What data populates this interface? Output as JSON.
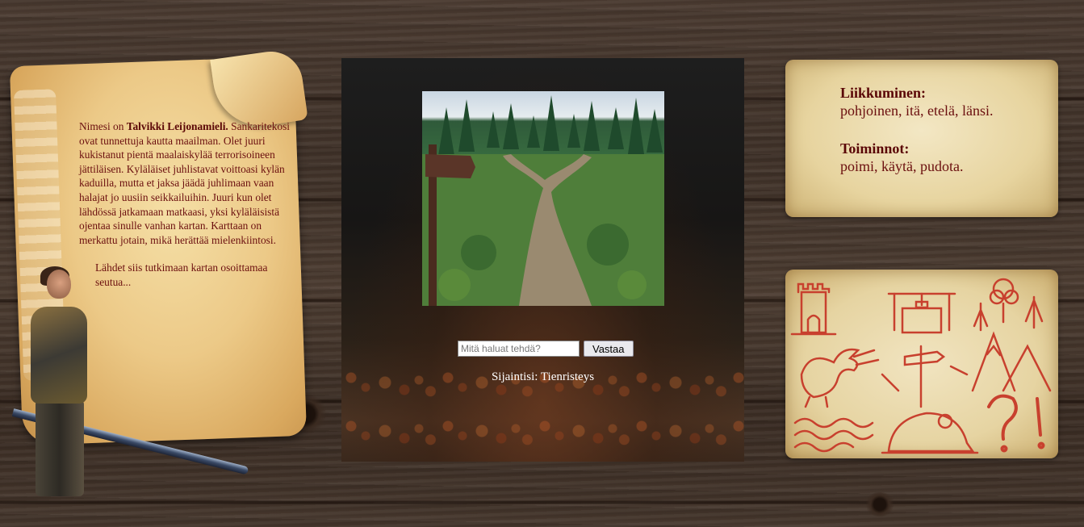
{
  "story": {
    "intro": "Nimesi on ",
    "hero_name": "Talvikki Leijonamieli.",
    "paragraph1": "Sankaritekosi ovat tunnettuja kautta maailman. Olet juuri kukistanut pientä maalaiskylää terrorisoineen jättiläisen. Kyläläiset juhlistavat voittoasi kylän kaduilla, mutta et jaksa jäädä juhlimaan vaan halajat jo uusiin seikkailuihin. Juuri kun olet lähdössä jatkamaan matkaasi, yksi kyläläisistä ojentaa sinulle vanhan kartan. Karttaan on merkattu jotain, mikä herättää mielenkiintosi.",
    "paragraph2": "Lähdet siis tutkimaan kartan osoittamaa seutua..."
  },
  "scene": {
    "image_label": "crossroads-forest-path"
  },
  "command": {
    "placeholder": "Mitä haluat tehdä?",
    "submit_label": "Vastaa"
  },
  "location": {
    "text": "Sijaintisi: Tienristeys"
  },
  "help": {
    "movement_title": "Liikkuminen:",
    "movement_commands": "pohjoinen, itä, etelä, länsi.",
    "actions_title": "Toiminnot:",
    "actions_commands": "poimi, käytä, pudota."
  },
  "map": {
    "icons": [
      "tower-icon",
      "well-icon",
      "trees-icon",
      "dragon-icon",
      "signpost-icon",
      "mountains-icon",
      "water-waves-icon",
      "skull-rock-icon",
      "question-exclamation-icon"
    ]
  },
  "colors": {
    "story_text": "#6b0f0f",
    "map_ink": "#c8402e",
    "panel_bg": "#171615"
  }
}
